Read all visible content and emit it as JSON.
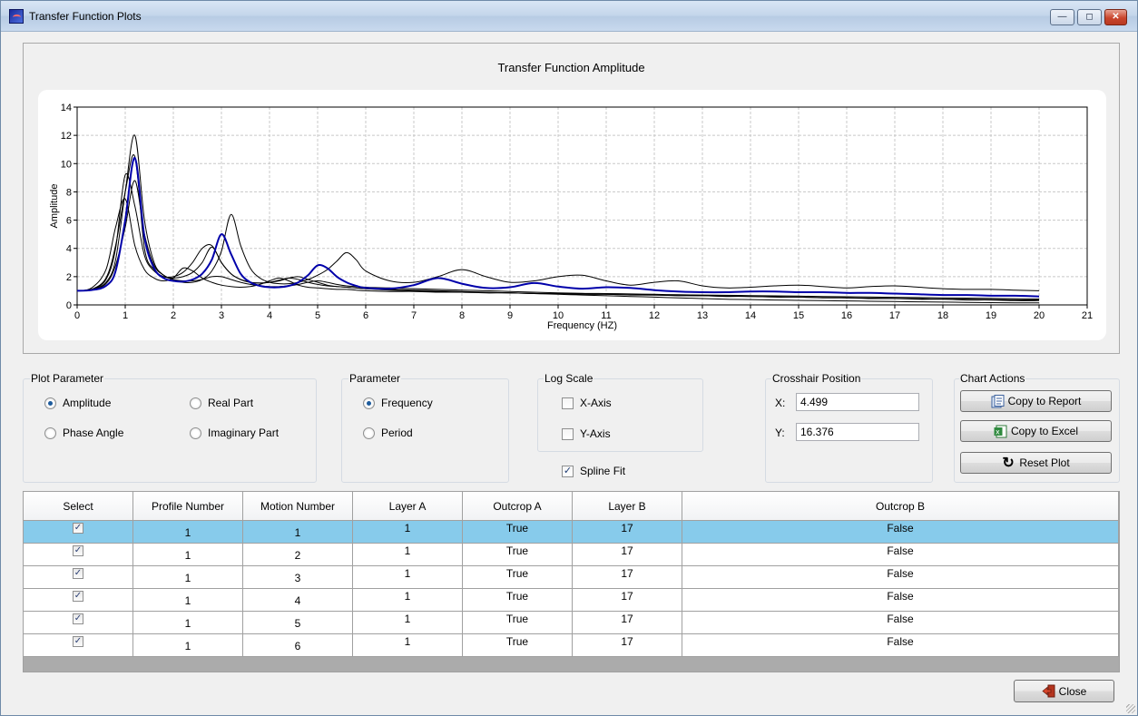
{
  "window": {
    "title": "Transfer Function Plots",
    "minimize_icon": "minimize-icon",
    "maximize_icon": "maximize-icon",
    "close_icon": "close-icon"
  },
  "chart": {
    "title": "Transfer Function Amplitude",
    "chart_data": {
      "type": "line",
      "title": "Transfer Function Amplitude",
      "xlabel": "Frequency (HZ)",
      "ylabel": "Amplitude",
      "xlim": [
        0,
        21
      ],
      "ylim": [
        0,
        14
      ],
      "xticks": [
        0,
        1,
        2,
        3,
        4,
        5,
        6,
        7,
        8,
        9,
        10,
        11,
        12,
        13,
        14,
        15,
        16,
        17,
        18,
        19,
        20,
        21
      ],
      "yticks": [
        0,
        2,
        4,
        6,
        8,
        10,
        12,
        14
      ],
      "grid": true,
      "x": [
        0,
        0.3,
        0.6,
        0.8,
        1,
        1.2,
        1.4,
        1.6,
        1.8,
        2,
        2.2,
        2.4,
        2.6,
        2.8,
        3,
        3.2,
        3.4,
        3.6,
        3.8,
        4,
        4.2,
        4.4,
        4.6,
        4.8,
        5,
        5.2,
        5.4,
        5.6,
        5.8,
        6,
        6.5,
        7,
        7.5,
        8,
        8.5,
        9,
        9.5,
        10,
        10.5,
        11,
        11.5,
        12,
        12.5,
        13,
        13.5,
        14,
        14.5,
        15,
        15.5,
        16,
        16.5,
        17,
        17.5,
        18,
        18.5,
        19,
        19.5,
        20
      ],
      "series": [
        {
          "color": "#0000aa",
          "values": [
            1,
            1.05,
            1.35,
            2.4,
            6,
            10.4,
            4.8,
            2.6,
            1.9,
            1.7,
            1.65,
            1.8,
            2.2,
            3.2,
            5,
            3.6,
            2.2,
            1.6,
            1.35,
            1.25,
            1.25,
            1.35,
            1.6,
            2.1,
            2.8,
            2.6,
            2,
            1.6,
            1.35,
            1.2,
            1.15,
            1.4,
            1.9,
            1.5,
            1.2,
            1.25,
            1.55,
            1.3,
            1.15,
            1.25,
            1.2,
            1.05,
            0.95,
            0.9,
            0.9,
            0.95,
            0.95,
            0.9,
            0.9,
            0.85,
            0.85,
            0.8,
            0.75,
            0.7,
            0.7,
            0.65,
            0.65,
            0.6
          ]
        },
        {
          "color": "#000000",
          "values": [
            1,
            1.1,
            1.6,
            3.2,
            8,
            12,
            6,
            3,
            2.1,
            1.8,
            1.6,
            1.6,
            1.8,
            2.4,
            3.8,
            6.4,
            4.2,
            2.6,
            1.9,
            1.6,
            1.5,
            1.5,
            1.6,
            1.8,
            2.1,
            2.5,
            3.1,
            3.7,
            3.2,
            2.4,
            1.7,
            1.6,
            2,
            2.5,
            2,
            1.6,
            1.7,
            2,
            2.1,
            1.7,
            1.4,
            1.6,
            1.7,
            1.35,
            1.2,
            1.25,
            1.35,
            1.4,
            1.3,
            1.2,
            1.3,
            1.35,
            1.25,
            1.15,
            1.1,
            1.1,
            1.05,
            1
          ]
        },
        {
          "color": "#000000",
          "values": [
            1,
            1.2,
            2.5,
            5.5,
            7.5,
            4.2,
            2.5,
            1.9,
            1.7,
            1.9,
            2.6,
            2.4,
            1.9,
            1.6,
            1.4,
            1.3,
            1.25,
            1.3,
            1.45,
            1.7,
            1.9,
            1.7,
            1.4,
            1.25,
            1.2,
            1.15,
            1.1,
            1.1,
            1.05,
            1,
            0.95,
            0.95,
            0.9,
            0.9,
            0.85,
            0.85,
            0.8,
            0.8,
            0.75,
            0.75,
            0.7,
            0.7,
            0.65,
            0.65,
            0.6,
            0.6,
            0.55,
            0.55,
            0.5,
            0.5,
            0.45,
            0.45,
            0.4,
            0.4,
            0.35,
            0.35,
            0.3,
            0.3
          ]
        },
        {
          "color": "#000000",
          "values": [
            1,
            1.1,
            1.8,
            4,
            9.2,
            7,
            3.5,
            2.4,
            2,
            2,
            2.3,
            3,
            4,
            4.2,
            3,
            2.2,
            1.8,
            1.6,
            1.55,
            1.6,
            1.75,
            1.9,
            1.8,
            1.6,
            1.45,
            1.35,
            1.3,
            1.25,
            1.2,
            1.15,
            1.1,
            1.05,
            1,
            0.95,
            0.9,
            0.85,
            0.8,
            0.75,
            0.7,
            0.65,
            0.6,
            0.55,
            0.5,
            0.45,
            0.4,
            0.38,
            0.35,
            0.32,
            0.3,
            0.28,
            0.26,
            0.24,
            0.22,
            0.2,
            0.18,
            0.16,
            0.15,
            0.15
          ]
        },
        {
          "color": "#000000",
          "values": [
            1,
            1.1,
            1.9,
            4.2,
            8,
            10.5,
            4,
            2.5,
            2,
            1.9,
            2,
            2.3,
            3,
            4.1,
            3,
            2.2,
            1.8,
            1.6,
            1.55,
            1.6,
            1.7,
            1.9,
            2,
            1.8,
            1.6,
            1.4,
            1.3,
            1.25,
            1.2,
            1.15,
            1.05,
            1,
            0.95,
            0.9,
            0.88,
            0.85,
            0.82,
            0.8,
            0.78,
            0.75,
            0.72,
            0.7,
            0.67,
            0.65,
            0.62,
            0.6,
            0.58,
            0.55,
            0.52,
            0.5,
            0.48,
            0.46,
            0.44,
            0.42,
            0.4,
            0.38,
            0.36,
            0.35
          ]
        },
        {
          "color": "#000000",
          "values": [
            1,
            1.05,
            1.5,
            2.8,
            5.5,
            8.8,
            5,
            2.8,
            2.1,
            1.8,
            1.7,
            1.7,
            1.8,
            2,
            2,
            1.8,
            1.6,
            1.45,
            1.35,
            1.3,
            1.3,
            1.35,
            1.45,
            1.6,
            1.7,
            1.6,
            1.45,
            1.35,
            1.3,
            1.25,
            1.2,
            1.15,
            1.1,
            1.05,
            1,
            0.95,
            0.9,
            0.85,
            0.82,
            0.8,
            0.78,
            0.75,
            0.72,
            0.7,
            0.68,
            0.66,
            0.64,
            0.62,
            0.6,
            0.58,
            0.56,
            0.54,
            0.52,
            0.5,
            0.48,
            0.46,
            0.44,
            0.42
          ]
        }
      ]
    }
  },
  "plot_parameter": {
    "label": "Plot Parameter",
    "options": [
      {
        "label": "Amplitude",
        "selected": true
      },
      {
        "label": "Real Part",
        "selected": false
      },
      {
        "label": "Phase Angle",
        "selected": false
      },
      {
        "label": "Imaginary Part",
        "selected": false
      }
    ]
  },
  "parameter": {
    "label": "Parameter",
    "options": [
      {
        "label": "Frequency",
        "selected": true
      },
      {
        "label": "Period",
        "selected": false
      }
    ]
  },
  "log_scale": {
    "label": "Log Scale",
    "x_axis": {
      "label": "X-Axis",
      "checked": false
    },
    "y_axis": {
      "label": "Y-Axis",
      "checked": false
    }
  },
  "spline_fit": {
    "label": "Spline Fit",
    "checked": true
  },
  "crosshair": {
    "label": "Crosshair Position",
    "x_label": "X:",
    "x_value": "4.499",
    "y_label": "Y:",
    "y_value": "16.376"
  },
  "chart_actions": {
    "label": "Chart Actions",
    "copy_report": "Copy to Report",
    "copy_excel": "Copy to Excel",
    "reset_plot": "Reset Plot"
  },
  "grid": {
    "columns": [
      "Select",
      "Profile Number",
      "Motion Number",
      "Layer A",
      "Outcrop A",
      "Layer B",
      "Outcrop B"
    ],
    "rows": [
      {
        "select": true,
        "profile": "1",
        "motion": "1",
        "layer_a": "1",
        "outcrop_a": "True",
        "layer_b": "17",
        "outcrop_b": "False",
        "selected": true
      },
      {
        "select": true,
        "profile": "1",
        "motion": "2",
        "layer_a": "1",
        "outcrop_a": "True",
        "layer_b": "17",
        "outcrop_b": "False",
        "selected": false
      },
      {
        "select": true,
        "profile": "1",
        "motion": "3",
        "layer_a": "1",
        "outcrop_a": "True",
        "layer_b": "17",
        "outcrop_b": "False",
        "selected": false
      },
      {
        "select": true,
        "profile": "1",
        "motion": "4",
        "layer_a": "1",
        "outcrop_a": "True",
        "layer_b": "17",
        "outcrop_b": "False",
        "selected": false
      },
      {
        "select": true,
        "profile": "1",
        "motion": "5",
        "layer_a": "1",
        "outcrop_a": "True",
        "layer_b": "17",
        "outcrop_b": "False",
        "selected": false
      },
      {
        "select": true,
        "profile": "1",
        "motion": "6",
        "layer_a": "1",
        "outcrop_a": "True",
        "layer_b": "17",
        "outcrop_b": "False",
        "selected": false
      }
    ]
  },
  "close_button": {
    "label": "Close"
  }
}
